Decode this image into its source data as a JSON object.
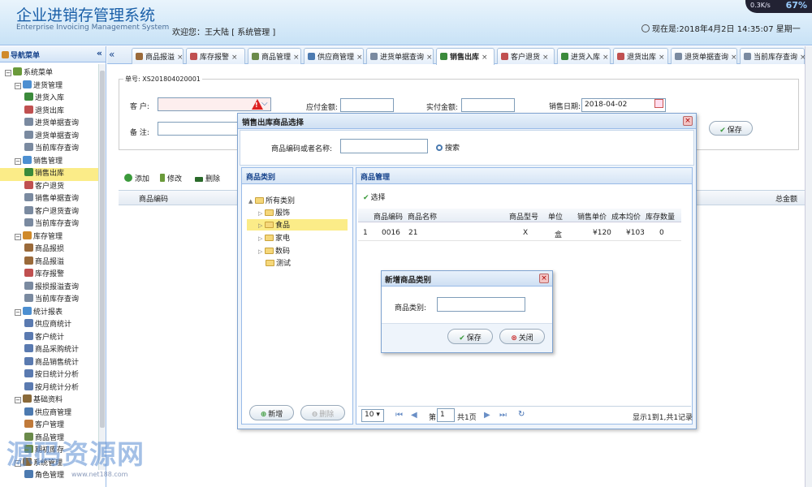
{
  "header": {
    "title": "企业进销存管理系统",
    "subtitle": "Enterprise Invoicing Management System",
    "welcome": "欢迎您：王大陆  [  系统管理  ]",
    "clock": "现在是:2018年4月2日 14:35:07 星期一",
    "net_speed": "0.3K/s",
    "net_pct": "67%"
  },
  "sidebar": {
    "title": "导航菜单",
    "collapse": "«",
    "tree": [
      {
        "level": 0,
        "label": "系统菜单",
        "toggle": "⊟",
        "icon": "#6a9a3a"
      },
      {
        "level": 1,
        "label": "进货管理",
        "toggle": "⊟",
        "icon": "#4c8fd1"
      },
      {
        "level": 2,
        "label": "进货入库",
        "icon": "#3b8a3b"
      },
      {
        "level": 2,
        "label": "退货出库",
        "icon": "#c05050"
      },
      {
        "level": 2,
        "label": "进货单据查询",
        "icon": "#7a8aa0"
      },
      {
        "level": 2,
        "label": "退货单据查询",
        "icon": "#7a8aa0"
      },
      {
        "level": 2,
        "label": "当前库存查询",
        "icon": "#7a8aa0"
      },
      {
        "level": 1,
        "label": "销售管理",
        "toggle": "⊟",
        "icon": "#4c8fd1"
      },
      {
        "level": 2,
        "label": "销售出库",
        "icon": "#3b8a3b",
        "selected": true
      },
      {
        "level": 2,
        "label": "客户退货",
        "icon": "#c05050"
      },
      {
        "level": 2,
        "label": "销售单据查询",
        "icon": "#7a8aa0"
      },
      {
        "level": 2,
        "label": "客户退货查询",
        "icon": "#7a8aa0"
      },
      {
        "level": 2,
        "label": "当前库存查询",
        "icon": "#7a8aa0"
      },
      {
        "level": 1,
        "label": "库存管理",
        "toggle": "⊟",
        "icon": "#d08a2a"
      },
      {
        "level": 2,
        "label": "商品报损",
        "icon": "#9a6a3a"
      },
      {
        "level": 2,
        "label": "商品报溢",
        "icon": "#9a6a3a"
      },
      {
        "level": 2,
        "label": "库存报警",
        "icon": "#c05050"
      },
      {
        "level": 2,
        "label": "报损报溢查询",
        "icon": "#7a8aa0"
      },
      {
        "level": 2,
        "label": "当前库存查询",
        "icon": "#7a8aa0"
      },
      {
        "level": 1,
        "label": "统计报表",
        "toggle": "⊟",
        "icon": "#4c8fd1"
      },
      {
        "level": 2,
        "label": "供应商统计",
        "icon": "#5a7ab0"
      },
      {
        "level": 2,
        "label": "客户统计",
        "icon": "#5a7ab0"
      },
      {
        "level": 2,
        "label": "商品采购统计",
        "icon": "#5a7ab0"
      },
      {
        "level": 2,
        "label": "商品销售统计",
        "icon": "#5a7ab0"
      },
      {
        "level": 2,
        "label": "按日统计分析",
        "icon": "#5a7ab0"
      },
      {
        "level": 2,
        "label": "按月统计分析",
        "icon": "#5a7ab0"
      },
      {
        "level": 1,
        "label": "基础资料",
        "toggle": "⊟",
        "icon": "#8a6a3a"
      },
      {
        "level": 2,
        "label": "供应商管理",
        "icon": "#4c7ab0"
      },
      {
        "level": 2,
        "label": "客户管理",
        "icon": "#c07a3a"
      },
      {
        "level": 2,
        "label": "商品管理",
        "icon": "#6a8a4a"
      },
      {
        "level": 2,
        "label": "期初库存",
        "icon": "#6a8a4a"
      },
      {
        "level": 1,
        "label": "系统管理",
        "toggle": "⊟",
        "icon": "#8a6a3a"
      },
      {
        "level": 2,
        "label": "角色管理",
        "icon": "#4c7ab0"
      }
    ]
  },
  "tabs": [
    {
      "label": "商品报溢",
      "icon": "#9a6a3a"
    },
    {
      "label": "库存报警",
      "icon": "#c05050"
    },
    {
      "label": "商品管理",
      "icon": "#6a8a4a"
    },
    {
      "label": "供应商管理",
      "icon": "#4c7ab0"
    },
    {
      "label": "进货单据查询",
      "icon": "#7a8aa0"
    },
    {
      "label": "销售出库",
      "icon": "#3b8a3b",
      "active": true
    },
    {
      "label": "客户退货",
      "icon": "#c05050"
    },
    {
      "label": "进货入库",
      "icon": "#3b8a3b"
    },
    {
      "label": "退货出库",
      "icon": "#c05050"
    },
    {
      "label": "退货单据查询",
      "icon": "#7a8aa0"
    },
    {
      "label": "当前库存查询",
      "icon": "#7a8aa0"
    }
  ],
  "tab_close": "×",
  "form": {
    "order_no": "单号: XS201804020001",
    "customer_label": "客  户:",
    "payable_label": "应付金额:",
    "paid_label": "实付金额:",
    "date_label": "销售日期:",
    "date_value": "2018-04-02",
    "note_label": "备  注:",
    "save": "保存"
  },
  "toolbar": {
    "add": "添加",
    "edit": "修改",
    "delete": "删除"
  },
  "grid": {
    "col_code": "商品编码",
    "col_total": "总金额"
  },
  "dialog": {
    "title": "销售出库商品选择",
    "search_label": "商品编码或者名称:",
    "search_button": "搜索",
    "category_title": "商品类别",
    "goods_title": "商品管理",
    "select_label": "选择",
    "categories": [
      "所有类别",
      "服饰",
      "食品",
      "家电",
      "数码",
      "测试"
    ],
    "columns": [
      "商品编码",
      "商品名称",
      "商品型号",
      "单位",
      "销售单价",
      "成本均价",
      "库存数量"
    ],
    "rows": [
      {
        "index": "1",
        "code": "0016",
        "name": "21",
        "model": "X",
        "unit": "盒",
        "price": "¥120",
        "cost": "¥103",
        "stock": "0"
      }
    ],
    "new_button": "新增",
    "delete_button": "删除",
    "pager": {
      "page_size": "10 ▾",
      "page_prefix": "第",
      "page_value": "1",
      "page_suffix": "共1页",
      "summary": "显示1到1,共1记录"
    }
  },
  "subdialog": {
    "title": "新增商品类别",
    "field_label": "商品类别:",
    "save": "保存",
    "close": "关闭"
  },
  "watermark": {
    "text": "源码资源网",
    "url": "www.net188.com"
  }
}
